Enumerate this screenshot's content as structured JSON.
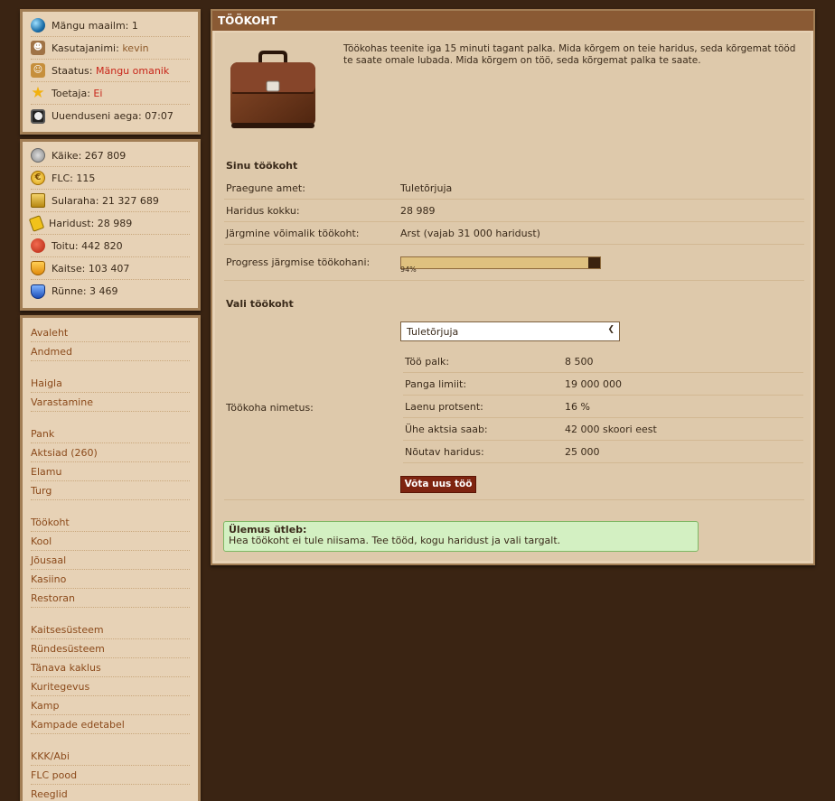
{
  "player": {
    "world_label": "Mängu maailm:",
    "world_value": "1",
    "user_label": "Kasutajanimi:",
    "user_value": "kevin",
    "status_label": "Staatus:",
    "status_value": "Mängu omanik",
    "supporter_label": "Toetaja:",
    "supporter_value": "Ei",
    "update_label": "Uuenduseni aega:",
    "update_value": "07:07"
  },
  "stats": {
    "moves_label": "Käike:",
    "moves_value": "267 809",
    "flc_label": "FLC:",
    "flc_value": "115",
    "cash_label": "Sularaha:",
    "cash_value": "21 327 689",
    "education_label": "Haridust:",
    "education_value": "28 989",
    "food_label": "Toitu:",
    "food_value": "442 820",
    "defense_label": "Kaitse:",
    "defense_value": "103 407",
    "attack_label": "Rünne:",
    "attack_value": "3 469"
  },
  "nav": {
    "g1": [
      "Avaleht",
      "Andmed"
    ],
    "g2": [
      "Haigla",
      "Varastamine"
    ],
    "g3": [
      "Pank",
      "Aktsiad (260)",
      "Elamu",
      "Turg"
    ],
    "g4": [
      "Töökoht",
      "Kool",
      "Jõusaal",
      "Kasiino",
      "Restoran"
    ],
    "g5": [
      "Kaitsesüsteem",
      "Ründesüsteem",
      "Tänava kaklus",
      "Kuritegevus",
      "Kamp",
      "Kampade edetabel"
    ],
    "g6": [
      "KKK/Abi",
      "FLC pood",
      "Reeglid"
    ]
  },
  "main": {
    "title": "TÖÖKOHT",
    "intro": "Töökohas teenite iga 15 minuti tagant palka. Mida kõrgem on teie haridus, seda kõrgemat tööd te saate omale lubada. Mida kõrgem on töö, seda kõrgemat palka te saate.",
    "your_job_title": "Sinu töökoht",
    "current_label": "Praegune amet:",
    "current_value": "Tuletõrjuja",
    "edu_total_label": "Haridus kokku:",
    "edu_total_value": "28 989",
    "next_label": "Järgmine võimalik töökoht:",
    "next_value": "Arst (vajab 31 000 haridust)",
    "progress_label": "Progress järgmise töökohani:",
    "progress_value": 0.94,
    "progress_text": "94%",
    "choose_title": "Vali töökoht",
    "select_value": "Tuletõrjuja",
    "job_name_label": "Töökoha nimetus:",
    "salary_label": "Töö palk:",
    "salary_value": "8 500",
    "bank_label": "Panga limiit:",
    "bank_value": "19 000 000",
    "loan_label": "Laenu protsent:",
    "loan_value": "16 %",
    "share_label": "Ühe aktsia saab:",
    "share_value": "42 000 skoori eest",
    "req_label": "Nõutav haridus:",
    "req_value": "25 000",
    "button": "Võta uus töö",
    "notice_title": "Ülemus ütleb:",
    "notice_text": "Hea töökoht ei tule niisama. Tee tööd, kogu haridust ja vali targalt."
  }
}
